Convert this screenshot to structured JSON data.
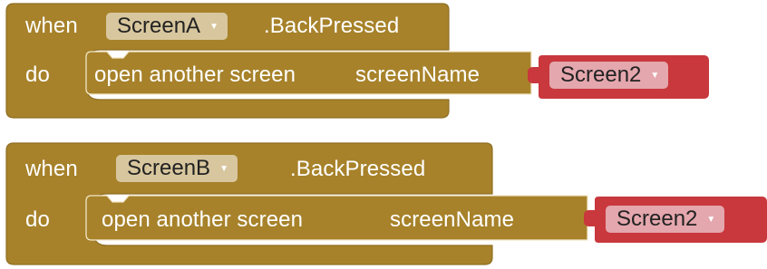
{
  "colors": {
    "event_block": "#a7822a",
    "event_block_edge": "#8e6e22",
    "string_block": "#c8383d",
    "component_dropdown": "#d8c79e",
    "string_dropdown": "#e4a7ad"
  },
  "blocks": [
    {
      "when_label": "when",
      "component": "ScreenA",
      "event": ".BackPressed",
      "do_label": "do",
      "call_label": "open another screen",
      "param_label": "screenName",
      "value": "Screen2"
    },
    {
      "when_label": "when",
      "component": "ScreenB",
      "event": ".BackPressed",
      "do_label": "do",
      "call_label": "open another screen",
      "param_label": "screenName",
      "value": "Screen2"
    }
  ],
  "icons": {
    "dropdown": "triangle-down"
  }
}
